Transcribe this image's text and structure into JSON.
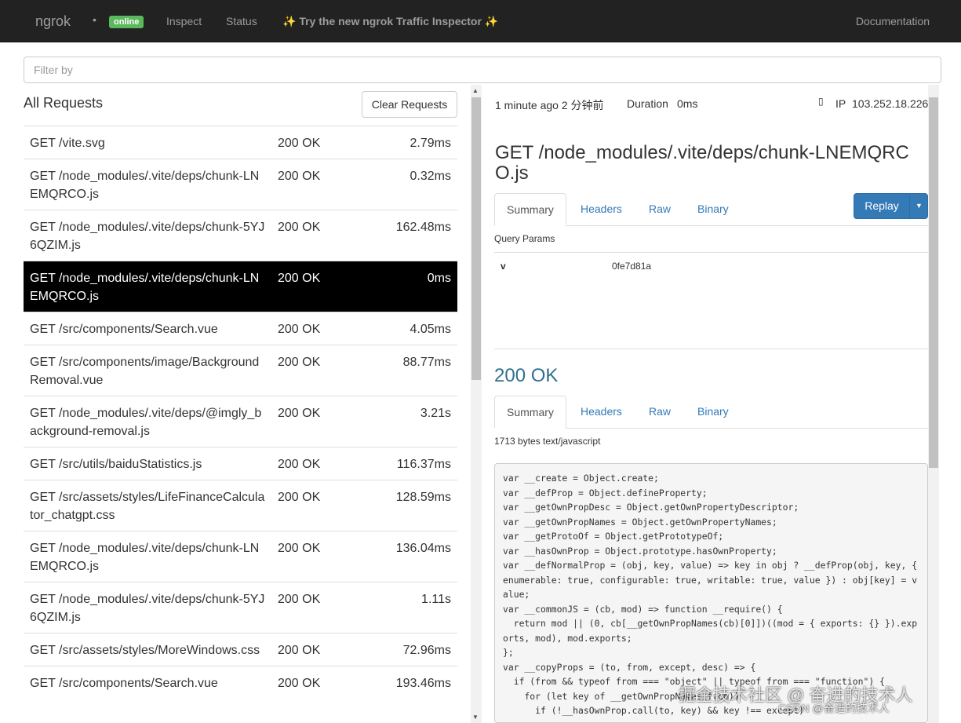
{
  "navbar": {
    "brand": "ngrok",
    "dot": "•",
    "status_badge": "online",
    "links": [
      "Inspect",
      "Status"
    ],
    "promo": "✨ Try the new ngrok Traffic Inspector ✨",
    "documentation": "Documentation"
  },
  "filter": {
    "placeholder": "Filter by"
  },
  "requests": {
    "title": "All Requests",
    "clear_label": "Clear Requests",
    "rows": [
      {
        "path": "GET /vite.svg",
        "status": "200 OK",
        "duration": "2.79ms"
      },
      {
        "path": "GET /node_modules/.vite/deps/chunk-LNEMQRCO.js",
        "status": "200 OK",
        "duration": "0.32ms"
      },
      {
        "path": "GET /node_modules/.vite/deps/chunk-5YJ6QZIM.js",
        "status": "200 OK",
        "duration": "162.48ms"
      },
      {
        "path": "GET /node_modules/.vite/deps/chunk-LNEMQRCO.js",
        "status": "200 OK",
        "duration": "0ms",
        "selected": true
      },
      {
        "path": "GET /src/components/Search.vue",
        "status": "200 OK",
        "duration": "4.05ms"
      },
      {
        "path": "GET /src/components/image/BackgroundRemoval.vue",
        "status": "200 OK",
        "duration": "88.77ms"
      },
      {
        "path": "GET /node_modules/.vite/deps/@imgly_background-removal.js",
        "status": "200 OK",
        "duration": "3.21s"
      },
      {
        "path": "GET /src/utils/baiduStatistics.js",
        "status": "200 OK",
        "duration": "116.37ms"
      },
      {
        "path": "GET /src/assets/styles/LifeFinanceCalculator_chatgpt.css",
        "status": "200 OK",
        "duration": "128.59ms"
      },
      {
        "path": "GET /node_modules/.vite/deps/chunk-LNEMQRCO.js",
        "status": "200 OK",
        "duration": "136.04ms"
      },
      {
        "path": "GET /node_modules/.vite/deps/chunk-5YJ6QZIM.js",
        "status": "200 OK",
        "duration": "1.11s"
      },
      {
        "path": "GET /src/assets/styles/MoreWindows.css",
        "status": "200 OK",
        "duration": "72.96ms"
      },
      {
        "path": "GET /src/components/Search.vue",
        "status": "200 OK",
        "duration": "193.46ms"
      }
    ]
  },
  "detail": {
    "time": "1 minute ago 2 分钟前",
    "duration_label": "Duration",
    "duration_value": "0ms",
    "ip_label": "IP",
    "ip_value": "103.252.18.226",
    "title": "GET /node_modules/.vite/deps/chunk-LNEMQRCO.js",
    "request_tabs": [
      "Summary",
      "Headers",
      "Raw",
      "Binary"
    ],
    "replay_label": "Replay",
    "query_params_label": "Query Params",
    "params": [
      {
        "key": "v",
        "value": "0fe7d81a"
      }
    ],
    "response_status": "200 OK",
    "response_tabs": [
      "Summary",
      "Headers",
      "Raw",
      "Binary"
    ],
    "response_meta": "1713 bytes text/javascript"
  },
  "code_lines": [
    "var __create = Object.create;",
    "var __defProp = Object.defineProperty;",
    "var __getOwnPropDesc = Object.getOwnPropertyDescriptor;",
    "var __getOwnPropNames = Object.getOwnPropertyNames;",
    "var __getProtoOf = Object.getPrototypeOf;",
    "var __hasOwnProp = Object.prototype.hasOwnProperty;",
    "var __defNormalProp = (obj, key, value) => key in obj ? __defProp(obj, key, { enumerable: true, configurable: true, writable: true, value }) : obj[key] = value;",
    "var __commonJS = (cb, mod) => function __require() {",
    "  return mod || (0, cb[__getOwnPropNames(cb)[0]])((mod = { exports: {} }).exports, mod), mod.exports;",
    "};",
    "var __copyProps = (to, from, except, desc) => {",
    "  if (from && typeof from === \"object\" || typeof from === \"function\") {",
    "    for (let key of __getOwnPropNames(from))",
    "      if (!__hasOwnProp.call(to, key) && key !== except)"
  ],
  "watermark": {
    "line1": "掘金技术社区 @ 奋进的技术人",
    "line2": "CSDN @奋进的技术人"
  }
}
